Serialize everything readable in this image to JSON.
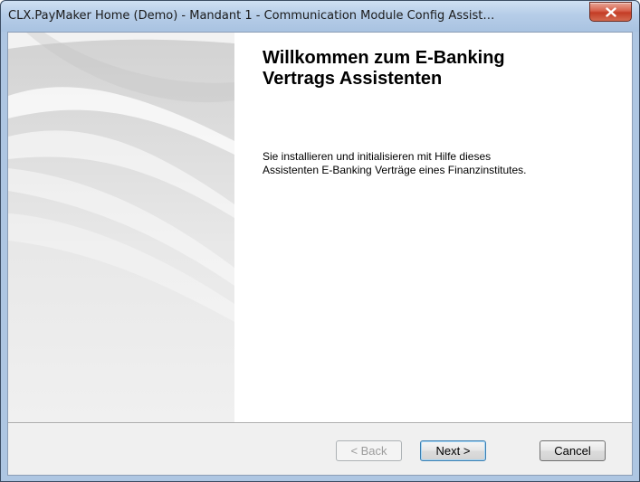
{
  "window": {
    "title": "CLX.PayMaker Home (Demo) - Mandant 1 - Communication Module Config Assist…"
  },
  "wizard": {
    "heading": "Willkommen zum E-Banking\nVertrags Assistenten",
    "description": "Sie installieren und initialisieren mit Hilfe dieses\nAssistenten E-Banking Verträge eines Finanzinstitutes."
  },
  "buttons": {
    "back": "< Back",
    "next": "Next >",
    "cancel": "Cancel"
  },
  "icons": {
    "close": "close-icon"
  },
  "colors": {
    "titlebar": "#b6cde8",
    "close_button": "#c43c25",
    "content_background": "#ffffff",
    "dialog_background": "#f0f0f0"
  }
}
